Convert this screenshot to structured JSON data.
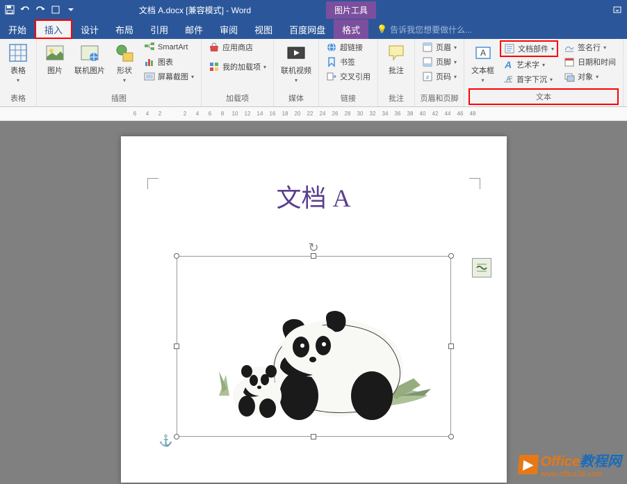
{
  "titlebar": {
    "document_title": "文档 A.docx [兼容模式] - Word",
    "picture_tools": "图片工具"
  },
  "tabs": {
    "home": "开始",
    "insert": "插入",
    "design": "设计",
    "layout": "布局",
    "references": "引用",
    "mailings": "邮件",
    "review": "审阅",
    "view": "视图",
    "baidu": "百度网盘",
    "format": "格式",
    "tell_me": "告诉我您想要做什么..."
  },
  "ribbon": {
    "tables": {
      "label": "表格",
      "btn": "表格"
    },
    "illustrations": {
      "label": "插图",
      "pictures": "图片",
      "online_pictures": "联机图片",
      "shapes": "形状",
      "smartart": "SmartArt",
      "chart": "图表",
      "screenshot": "屏幕截图"
    },
    "addins": {
      "label": "加载项",
      "store": "应用商店",
      "my_addins": "我的加载项"
    },
    "media": {
      "label": "媒体",
      "online_video": "联机视频"
    },
    "links": {
      "label": "链接",
      "hyperlink": "超链接",
      "bookmark": "书签",
      "cross_reference": "交叉引用"
    },
    "comments": {
      "label": "批注",
      "btn": "批注"
    },
    "header_footer": {
      "label": "页眉和页脚",
      "header": "页眉",
      "footer": "页脚",
      "page_number": "页码"
    },
    "text": {
      "label": "文本",
      "text_box": "文本框",
      "quick_parts": "文档部件",
      "word_art": "艺术字",
      "drop_cap": "首字下沉",
      "signature_line": "签名行",
      "date_time": "日期和时间",
      "object": "对象"
    }
  },
  "ruler_marks": [
    "6",
    "4",
    "2",
    "",
    "2",
    "4",
    "6",
    "8",
    "10",
    "12",
    "14",
    "16",
    "18",
    "20",
    "22",
    "24",
    "26",
    "28",
    "30",
    "32",
    "34",
    "36",
    "38",
    "40",
    "42",
    "44",
    "46",
    "48"
  ],
  "document": {
    "title": "文档 A"
  },
  "watermark": {
    "brand_main": "Office",
    "brand_suffix": "教程网",
    "url": "www.office26.com"
  }
}
